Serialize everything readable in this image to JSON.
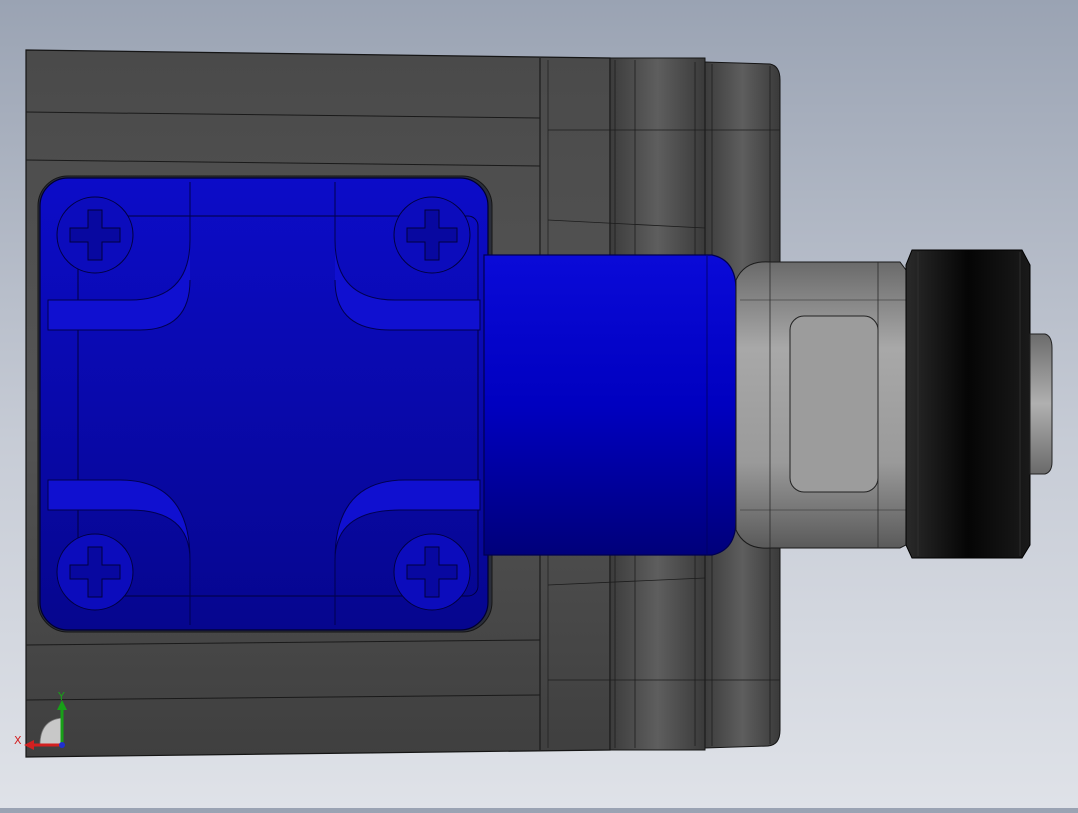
{
  "viewport": {
    "background_top": "#9aa3b3",
    "background_bottom": "#dfe2e8"
  },
  "model": {
    "housing_color": "#4f4f4f",
    "housing_edge_color": "#1a1a1a",
    "cover_color": "#0a0ab4",
    "cover_highlight": "#2a2af0",
    "cover_shadow": "#050570",
    "bushing_color": "#0000b8",
    "nut_color": "#8a8a8a",
    "roller_color": "#111111",
    "shaft_color": "#a0a0a0"
  },
  "triad": {
    "x_label": "X",
    "y_label": "Y",
    "x_color": "#d22020",
    "y_color": "#18a018",
    "z_color": "#2030d0"
  }
}
